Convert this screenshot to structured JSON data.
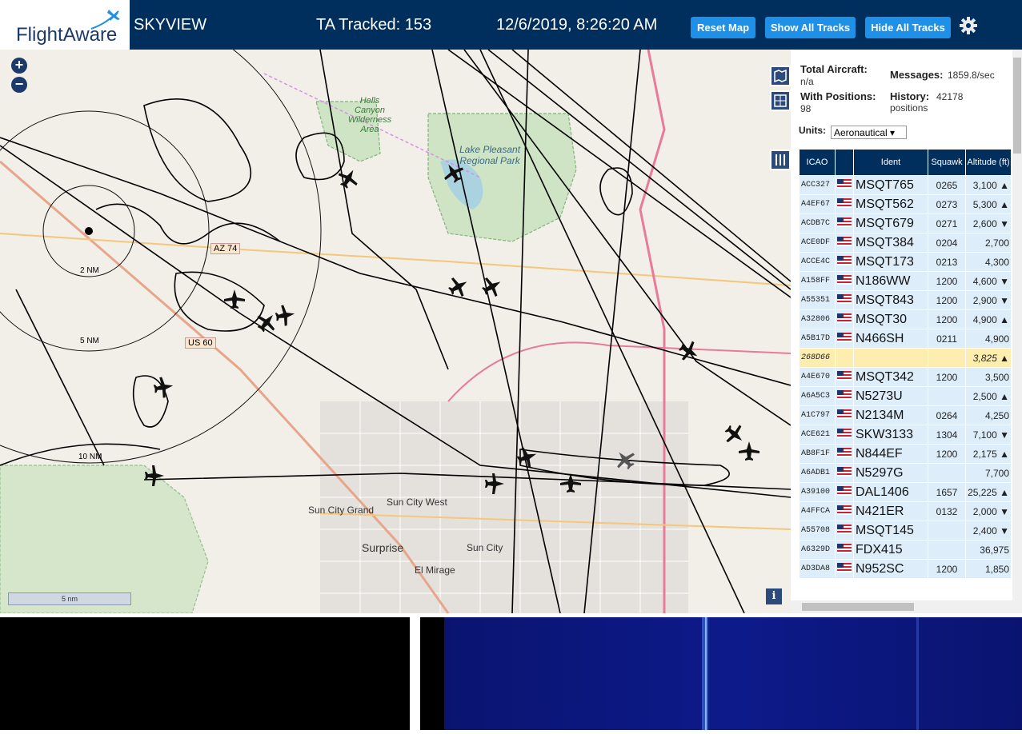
{
  "header": {
    "logo_text": "FlightAware",
    "app_name": "SKYVIEW",
    "tracked": "TA Tracked: 153",
    "datetime": "12/6/2019, 8:26:20 AM",
    "reset_map": "Reset Map",
    "show_all_tracks": "Show All Tracks",
    "hide_all_tracks": "Hide All Tracks",
    "settings_icon": "gear-icon"
  },
  "map": {
    "zoom_in": "+",
    "zoom_out": "−",
    "scale": "5 nm",
    "info": "i",
    "labels": {
      "hells_canyon": "Hells Canyon Wilderness Area",
      "lake_pleasant": "Lake Pleasant Regional Park",
      "az74": "AZ 74",
      "us60": "US 60",
      "nm2": "2 NM",
      "nm5": "5 NM",
      "nm10": "10 NM",
      "sun_city_grand": "Sun City Grand",
      "sun_city_west": "Sun City West",
      "surprise": "Surprise",
      "sun_city": "Sun City",
      "el_mirage": "El Mirage"
    }
  },
  "stats": {
    "total_label": "Total Aircraft:",
    "total_value": "n/a",
    "positions_label": "With Positions:",
    "positions_value": "98",
    "messages_label": "Messages:",
    "messages_value": "1859.8/sec",
    "history_label": "History:",
    "history_value": "42178 positions"
  },
  "units": {
    "label": "Units:",
    "selected": "Aeronautical ▾"
  },
  "table": {
    "headers": {
      "icao": "ICAO",
      "ident": "Ident",
      "squawk": "Squawk",
      "altitude": "Altitude (ft)"
    },
    "rows": [
      {
        "icao": "ACC327",
        "ident": "MSQT765",
        "squawk": "0265",
        "alt": "3,100 ▲"
      },
      {
        "icao": "A4EF67",
        "ident": "MSQT562",
        "squawk": "0273",
        "alt": "5,300 ▲"
      },
      {
        "icao": "ACDB7C",
        "ident": "MSQT679",
        "squawk": "0271",
        "alt": "2,600 ▼"
      },
      {
        "icao": "ACE0DF",
        "ident": "MSQT384",
        "squawk": "0204",
        "alt": "2,700"
      },
      {
        "icao": "ACCE4C",
        "ident": "MSQT173",
        "squawk": "0213",
        "alt": "4,300"
      },
      {
        "icao": "A158FF",
        "ident": "N186WW",
        "squawk": "1200",
        "alt": "4,600 ▼"
      },
      {
        "icao": "A55351",
        "ident": "MSQT843",
        "squawk": "1200",
        "alt": "2,900 ▼"
      },
      {
        "icao": "A32806",
        "ident": "MSQT30",
        "squawk": "1200",
        "alt": "4,900 ▲"
      },
      {
        "icao": "A5B17D",
        "ident": "N466SH",
        "squawk": "0211",
        "alt": "4,900"
      },
      {
        "icao": "268D66",
        "ident": "",
        "squawk": "",
        "alt": "3,825 ▲"
      },
      {
        "icao": "A4E670",
        "ident": "MSQT342",
        "squawk": "1200",
        "alt": "3,500"
      },
      {
        "icao": "A6A5C3",
        "ident": "N5273U",
        "squawk": "",
        "alt": "2,500 ▲"
      },
      {
        "icao": "A1C797",
        "ident": "N2134M",
        "squawk": "0264",
        "alt": "4,250"
      },
      {
        "icao": "ACE621",
        "ident": "SKW3133",
        "squawk": "1304",
        "alt": "7,100 ▼"
      },
      {
        "icao": "AB8F1F",
        "ident": "N844EF",
        "squawk": "1200",
        "alt": "2,175 ▲"
      },
      {
        "icao": "A6ADB1",
        "ident": "N5297G",
        "squawk": "",
        "alt": "7,700"
      },
      {
        "icao": "A39100",
        "ident": "DAL1406",
        "squawk": "1657",
        "alt": "25,225 ▲"
      },
      {
        "icao": "A4FFCA",
        "ident": "N421ER",
        "squawk": "0132",
        "alt": "2,000 ▼"
      },
      {
        "icao": "A55708",
        "ident": "MSQT145",
        "squawk": "",
        "alt": "2,400 ▼"
      },
      {
        "icao": "A6329D",
        "ident": "FDX415",
        "squawk": "",
        "alt": "36,975"
      },
      {
        "icao": "AD3DA8",
        "ident": "N952SC",
        "squawk": "1200",
        "alt": "1,850"
      }
    ]
  }
}
